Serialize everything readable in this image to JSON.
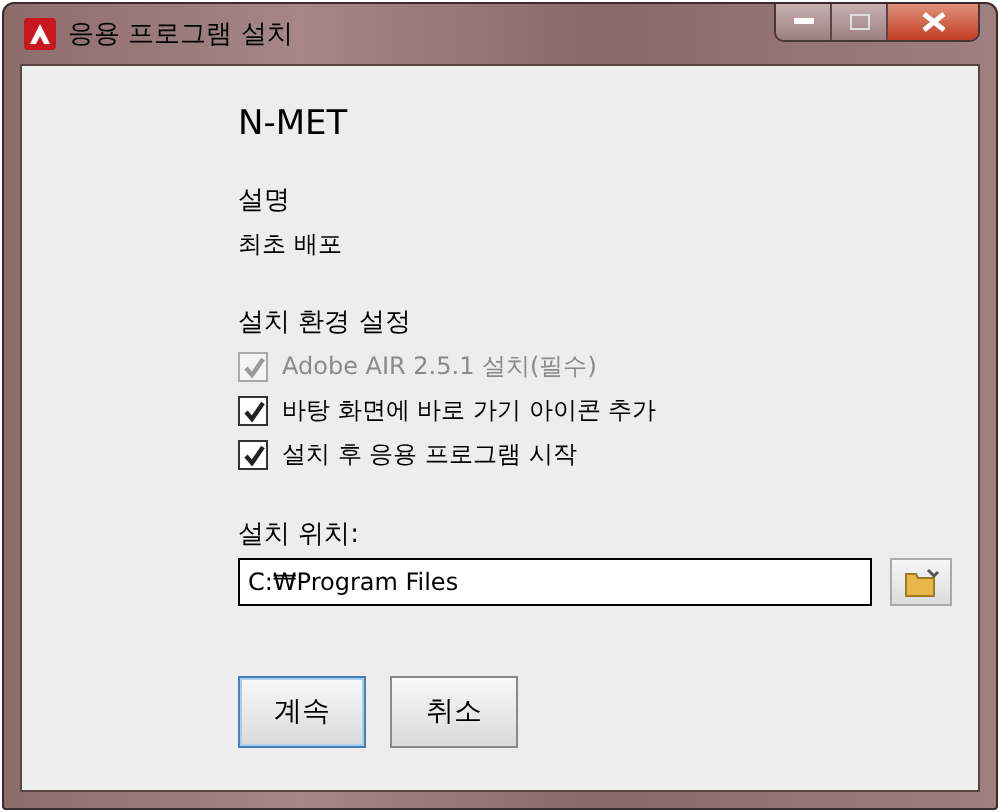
{
  "window": {
    "title": "응용 프로그램 설치"
  },
  "app_name": "N-MET",
  "description": {
    "label": "설명",
    "text": "최초 배포"
  },
  "settings": {
    "label": "설치 환경 설정",
    "options": [
      {
        "label": "Adobe AIR 2.5.1 설치(필수)",
        "checked": true,
        "disabled": true
      },
      {
        "label": "바탕 화면에 바로 가기 아이콘 추가",
        "checked": true,
        "disabled": false
      },
      {
        "label": "설치 후 응용 프로그램 시작",
        "checked": true,
        "disabled": false
      }
    ]
  },
  "location": {
    "label": "설치 위치:",
    "value": "C:₩Program Files"
  },
  "buttons": [
    {
      "label": "계속",
      "default": true
    },
    {
      "label": "취소",
      "default": false
    }
  ]
}
